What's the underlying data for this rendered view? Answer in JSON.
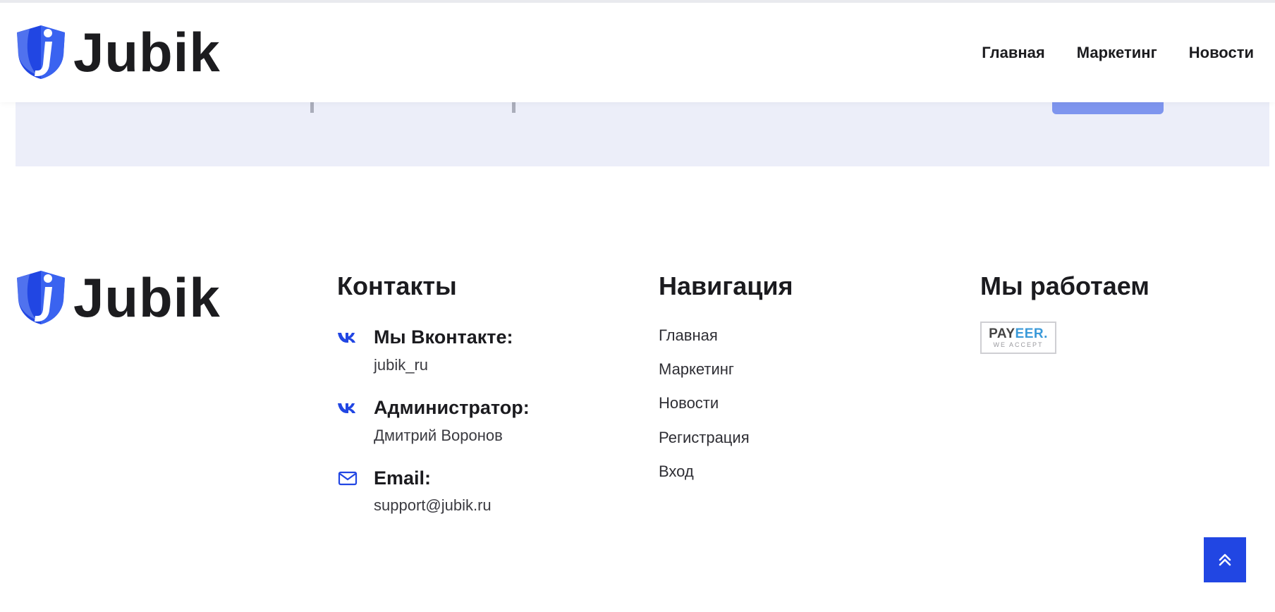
{
  "brand": {
    "name": "Jubik",
    "accent_color": "#2146e3",
    "logo_icon": "shield-j-icon"
  },
  "header": {
    "nav": [
      {
        "label": "Главная"
      },
      {
        "label": "Маркетинг"
      },
      {
        "label": "Новости"
      }
    ]
  },
  "footer": {
    "contacts": {
      "title": "Контакты",
      "items": [
        {
          "icon": "vk-icon",
          "title": "Мы Вконтакте:",
          "value": "jubik_ru"
        },
        {
          "icon": "vk-icon",
          "title": "Администратор:",
          "value": "Дмитрий Воронов"
        },
        {
          "icon": "mail-icon",
          "title": "Email:",
          "value": "support@jubik.ru"
        }
      ]
    },
    "navigation": {
      "title": "Навигация",
      "links": [
        "Главная",
        "Маркетинг",
        "Новости",
        "Регистрация",
        "Вход"
      ]
    },
    "work": {
      "title": "Мы работаем",
      "payment_badge": {
        "name_part1": "PAY",
        "name_part2": "EER.",
        "subtitle": "WE ACCEPT"
      }
    }
  },
  "scroll_top": {
    "icon": "double-chevron-up-icon"
  }
}
